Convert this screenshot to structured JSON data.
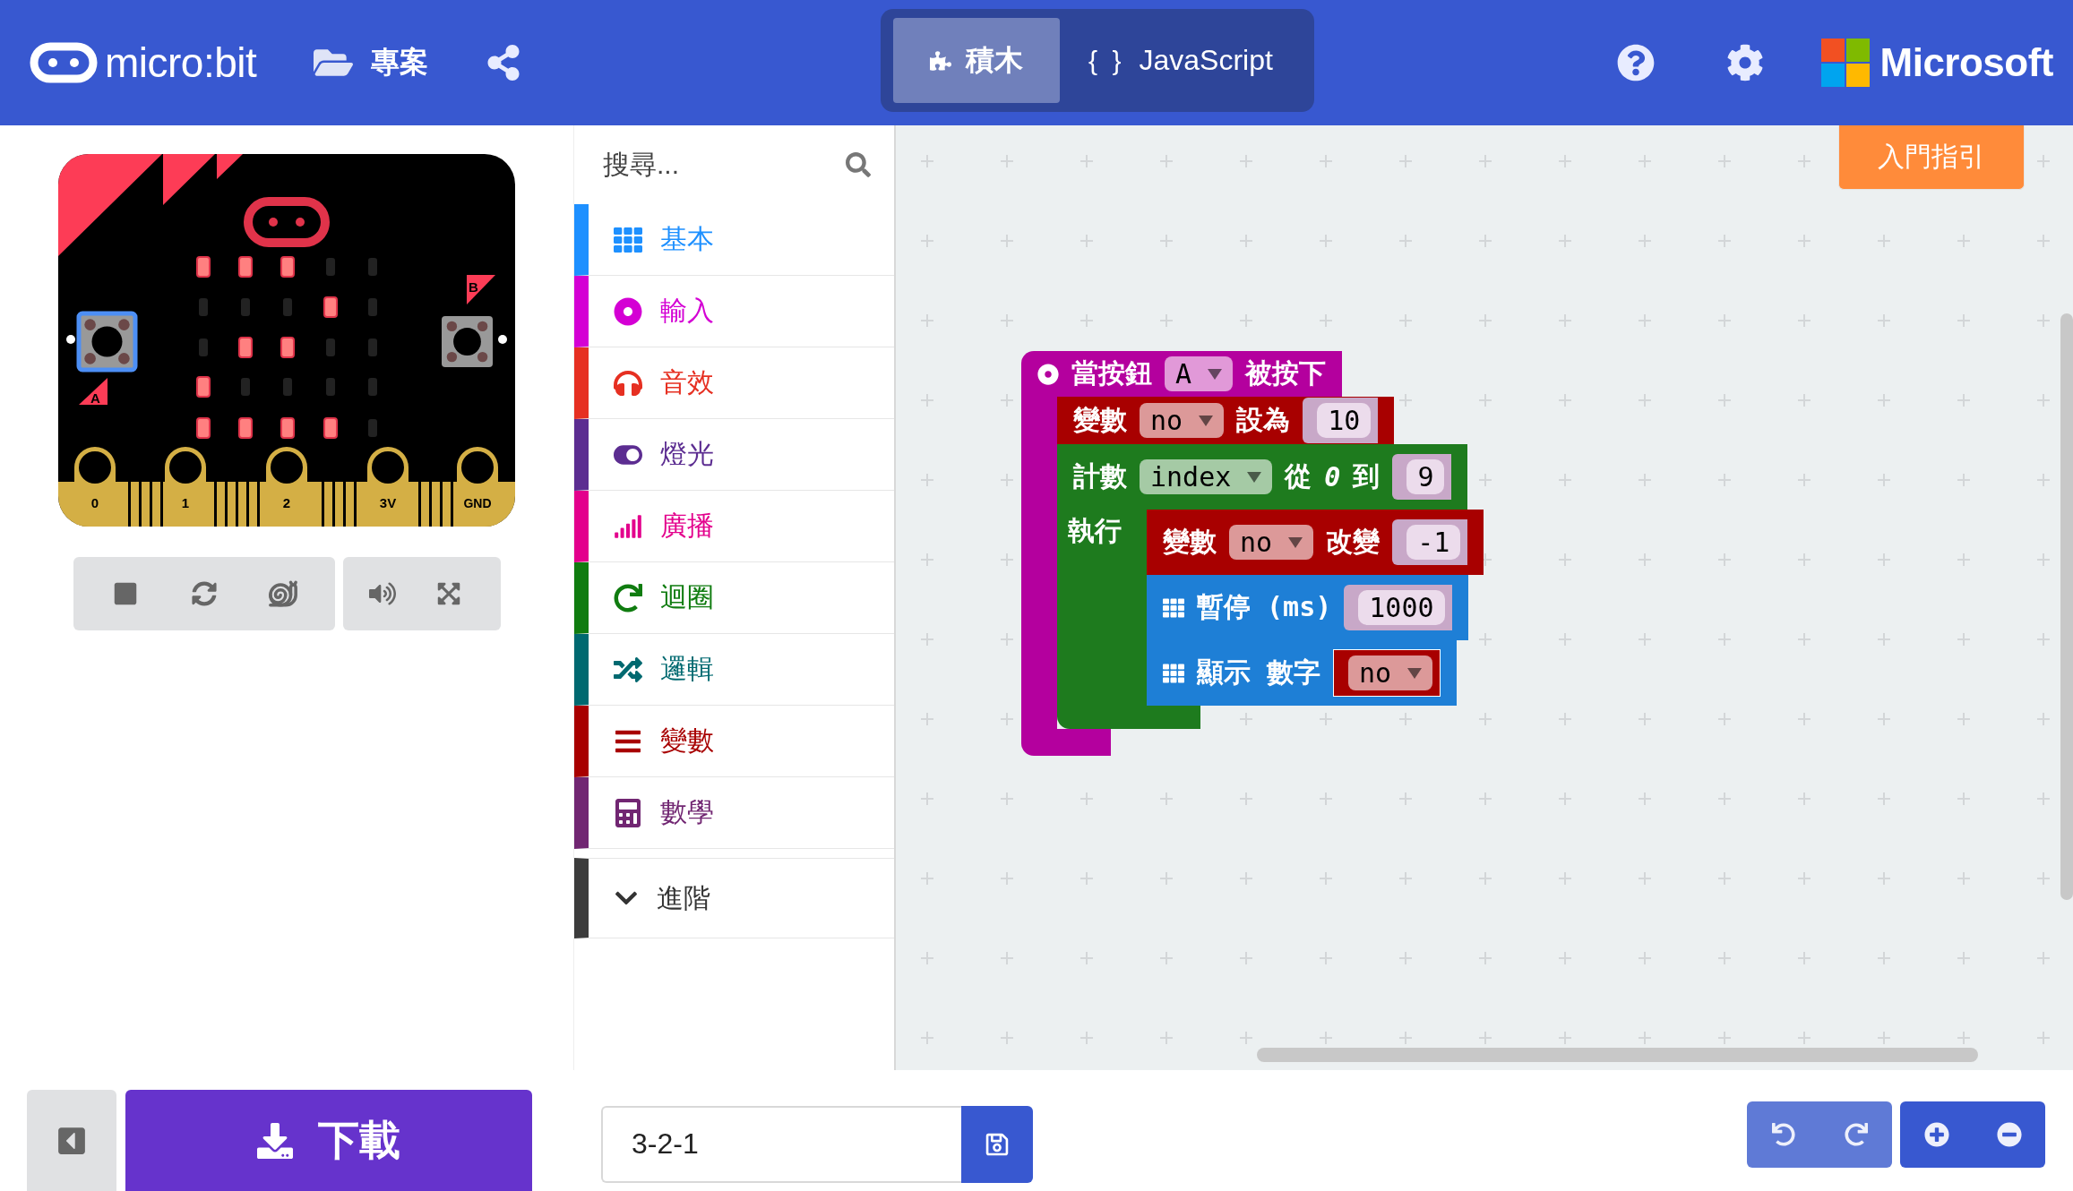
{
  "header": {
    "logo": "micro:bit",
    "nav": [
      {
        "label": "專案"
      }
    ],
    "editor_tabs": [
      {
        "kind": "blocks",
        "label": "積木",
        "selected": true
      },
      {
        "kind": "code",
        "prefix": "{ }",
        "label": "JavaScript",
        "selected": false
      }
    ],
    "brand": "Microsoft"
  },
  "simulator": {
    "led_rows": [
      [
        true,
        true,
        true,
        false,
        false
      ],
      [
        false,
        false,
        false,
        true,
        false
      ],
      [
        false,
        true,
        true,
        false,
        false
      ],
      [
        true,
        false,
        false,
        false,
        false
      ],
      [
        true,
        true,
        true,
        true,
        false
      ]
    ],
    "button_labels": [
      "A",
      "B"
    ],
    "pins": [
      "0",
      "1",
      "2",
      "3V",
      "GND"
    ]
  },
  "toolbox": {
    "search_placeholder": "搜尋...",
    "categories": [
      {
        "kind": "basic",
        "label": "基本",
        "color": "#1e90ff"
      },
      {
        "kind": "input",
        "label": "輸入",
        "color": "#d400d4"
      },
      {
        "kind": "music",
        "label": "音效",
        "color": "#e63022"
      },
      {
        "kind": "led",
        "label": "燈光",
        "color": "#5c2d91"
      },
      {
        "kind": "radio",
        "label": "廣播",
        "color": "#e3008c"
      },
      {
        "kind": "loops",
        "label": "迴圈",
        "color": "#107c10"
      },
      {
        "kind": "logic",
        "label": "邏輯",
        "color": "#006970"
      },
      {
        "kind": "variables",
        "label": "變數",
        "color": "#a80000"
      },
      {
        "kind": "math",
        "label": "數學",
        "color": "#712672"
      }
    ],
    "advanced": "進階"
  },
  "tour_button": "入門指引",
  "program": {
    "kind": "event",
    "color": "#b4009e",
    "parts": [
      {
        "kind": "text",
        "text": "當按鈕"
      },
      {
        "kind": "dropdown",
        "text": "A"
      },
      {
        "kind": "text",
        "text": "被按下"
      }
    ],
    "children": [
      {
        "kind": "statement",
        "color": "#a80000",
        "parts": [
          {
            "kind": "text",
            "text": "變數"
          },
          {
            "kind": "dropdown",
            "text": "no"
          },
          {
            "kind": "text",
            "text": "設為"
          },
          {
            "kind": "number",
            "text": "10"
          }
        ]
      },
      {
        "kind": "loop",
        "color": "#1e7b1e",
        "do_label": "執行",
        "parts": [
          {
            "kind": "text",
            "text": "計數"
          },
          {
            "kind": "dropdown",
            "text": "index"
          },
          {
            "kind": "text",
            "text": "從"
          },
          {
            "kind": "literal",
            "text": "0"
          },
          {
            "kind": "text",
            "text": "到"
          },
          {
            "kind": "number",
            "text": "9"
          }
        ],
        "children": [
          {
            "kind": "statement",
            "color": "#a80000",
            "parts": [
              {
                "kind": "text",
                "text": "變數"
              },
              {
                "kind": "dropdown",
                "text": "no"
              },
              {
                "kind": "text",
                "text": "改變"
              },
              {
                "kind": "number",
                "text": "-1"
              }
            ]
          },
          {
            "kind": "basic",
            "color": "#1e7fd6",
            "parts": [
              {
                "kind": "text",
                "text": "暫停 (ms)"
              },
              {
                "kind": "number",
                "text": "1000"
              }
            ]
          },
          {
            "kind": "basic",
            "color": "#1e7fd6",
            "parts": [
              {
                "kind": "text",
                "text": "顯示 數字"
              },
              {
                "kind": "variable",
                "text": "no"
              }
            ]
          }
        ]
      }
    ]
  },
  "download": "下載",
  "project_name": "3-2-1"
}
